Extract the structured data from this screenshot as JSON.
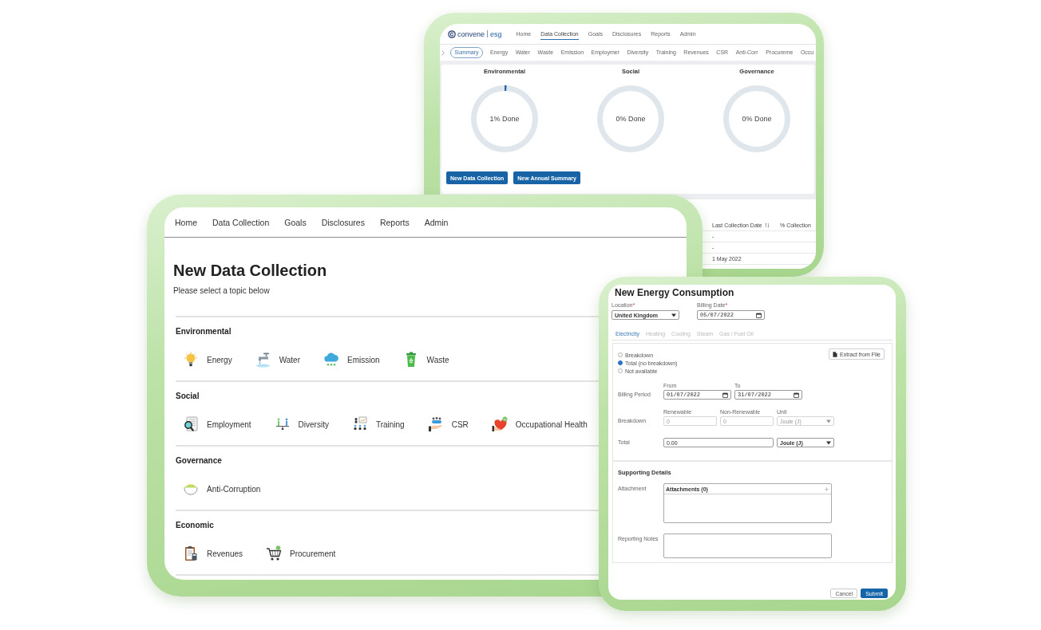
{
  "dashboard": {
    "logo": {
      "brand": "convene",
      "product": "esg"
    },
    "nav": [
      {
        "label": "Home",
        "selected": false
      },
      {
        "label": "Data Collection",
        "selected": true
      },
      {
        "label": "Goals",
        "selected": false
      },
      {
        "label": "Disclosures",
        "selected": false
      },
      {
        "label": "Reports",
        "selected": false
      },
      {
        "label": "Admin",
        "selected": false
      }
    ],
    "tabs": [
      {
        "label": "Summary",
        "selected": true
      },
      {
        "label": "Energy",
        "selected": false
      },
      {
        "label": "Water",
        "selected": false
      },
      {
        "label": "Waste",
        "selected": false
      },
      {
        "label": "Emission",
        "selected": false
      },
      {
        "label": "Employmer",
        "selected": false
      },
      {
        "label": "Diversity",
        "selected": false
      },
      {
        "label": "Training",
        "selected": false
      },
      {
        "label": "Revenues",
        "selected": false
      },
      {
        "label": "CSR",
        "selected": false
      },
      {
        "label": "Anti-Corr",
        "selected": false
      },
      {
        "label": "Procureme",
        "selected": false
      },
      {
        "label": "Occu",
        "selected": false
      }
    ],
    "progress": [
      {
        "title": "Environmental",
        "reading": "1% Done",
        "level": 0.01
      },
      {
        "title": "Social",
        "reading": "0% Done",
        "level": 0
      },
      {
        "title": "Governance",
        "reading": "0% Done",
        "level": 0
      }
    ],
    "buttons": [
      "New Data Collection",
      "New Annual Summary"
    ],
    "table": {
      "columns": [
        {
          "label": "Last Collection Date",
          "sortable": true
        },
        {
          "label": "% Collection",
          "sortable": false
        }
      ],
      "rows": [
        [
          "-"
        ],
        [
          "-"
        ],
        [
          "1 May 2022"
        ]
      ]
    }
  },
  "data_collection": {
    "nav": [
      "Home",
      "Data Collection",
      "Goals",
      "Disclosures",
      "Reports",
      "Admin"
    ],
    "title": "New Data Collection",
    "subtitle": "Please select a topic below",
    "sections": [
      {
        "title": "Environmental",
        "topics": [
          "Energy",
          "Water",
          "Emission",
          "Waste"
        ]
      },
      {
        "title": "Social",
        "topics": [
          "Employment",
          "Diversity",
          "Training",
          "CSR",
          "Occupational Health"
        ]
      },
      {
        "title": "Governance",
        "topics": [
          "Anti-Corruption"
        ]
      },
      {
        "title": "Economic",
        "topics": [
          "Revenues",
          "Procurement"
        ]
      }
    ]
  },
  "energy_form": {
    "title": "New Energy Consumption",
    "location": {
      "label": "Location",
      "required_mark": "*",
      "value": "United Kingdom"
    },
    "billing_date": {
      "label": "Billing Date",
      "required_mark": "*",
      "value": "05/07/2022"
    },
    "tabs": [
      {
        "label": "Electricity",
        "selected": true
      },
      {
        "label": "Heating",
        "selected": false
      },
      {
        "label": "Cooling",
        "selected": false
      },
      {
        "label": "Steam",
        "selected": false
      },
      {
        "label": "Gas / Fuel Oil",
        "selected": false
      }
    ],
    "options": [
      {
        "label": "Breakdown",
        "selected": false
      },
      {
        "label": "Total (no breakdown)",
        "selected": true
      },
      {
        "label": "Not available",
        "selected": false
      }
    ],
    "extract_button": "Extract from File",
    "billing_period": {
      "label": "Billing Period",
      "fields": [
        {
          "label": "From",
          "value": "01/07/2022",
          "kind": "date"
        },
        {
          "label": "To",
          "value": "31/07/2022",
          "kind": "date"
        }
      ]
    },
    "breakdown": {
      "label": "Breakdown",
      "fields": [
        {
          "label": "Renewable",
          "value": "0",
          "kind": "number",
          "disabled": true
        },
        {
          "label": "Non-Renewable",
          "value": "0",
          "kind": "number",
          "disabled": true
        },
        {
          "label": "Unit",
          "value": "Joule (J)",
          "kind": "select",
          "disabled": true
        }
      ]
    },
    "total": {
      "label": "Total",
      "fields": [
        {
          "value": "0.00",
          "kind": "number",
          "disabled": false
        },
        {
          "value": "Joule (J)",
          "kind": "select",
          "disabled": false
        }
      ]
    },
    "supporting_title": "Supporting Details",
    "attachment": {
      "label": "Attachment",
      "title": "Attachments (0)"
    },
    "notes": {
      "label": "Reporting Notes"
    },
    "buttons": [
      {
        "label": "Cancel",
        "kind": "secondary"
      },
      {
        "label": "Submit",
        "kind": "primary"
      }
    ]
  }
}
